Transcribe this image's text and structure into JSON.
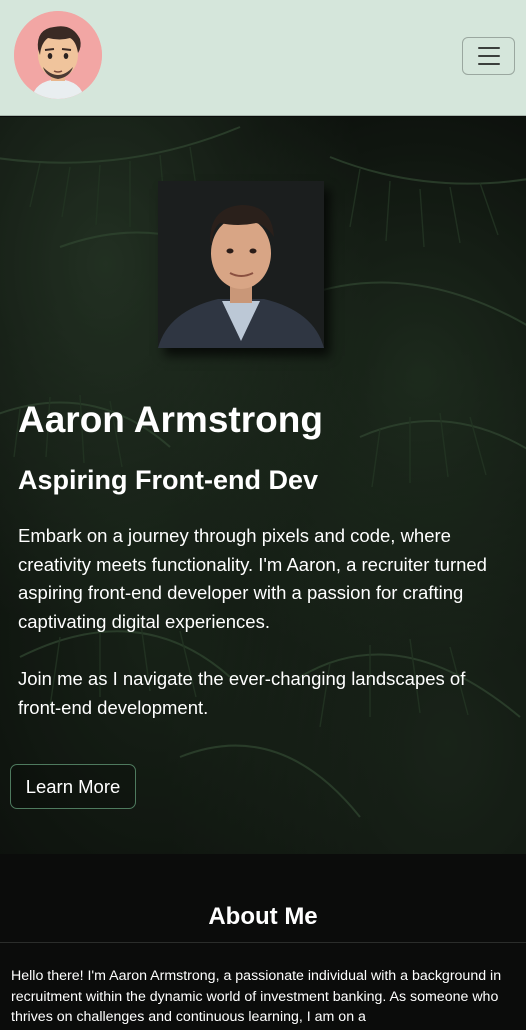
{
  "navbar": {
    "logo_icon": "cartoon-avatar-logo",
    "menu_icon": "hamburger-menu-icon"
  },
  "hero": {
    "portrait_icon": "headshot-photo",
    "name": "Aaron Armstrong",
    "role": "Aspiring Front-end Dev",
    "paragraph_1": "Embark on a journey through pixels and code, where creativity meets functionality. I'm Aaron, a recruiter turned aspiring front-end developer with a passion for crafting captivating digital experiences.",
    "paragraph_2": "Join me as I navigate the ever-changing landscapes of front-end development.",
    "button_label": "Learn More"
  },
  "about": {
    "title": "About Me",
    "text": "Hello there! I'm Aaron Armstrong, a passionate individual with a background in recruitment within the dynamic world of investment banking. As someone who thrives on challenges and continuous learning, I am on a"
  },
  "colors": {
    "navbar_bg": "#d5e6db",
    "logo_bg": "#f2a6a4",
    "button_border": "#4e7a5e",
    "page_bg": "#0b0c0b"
  }
}
